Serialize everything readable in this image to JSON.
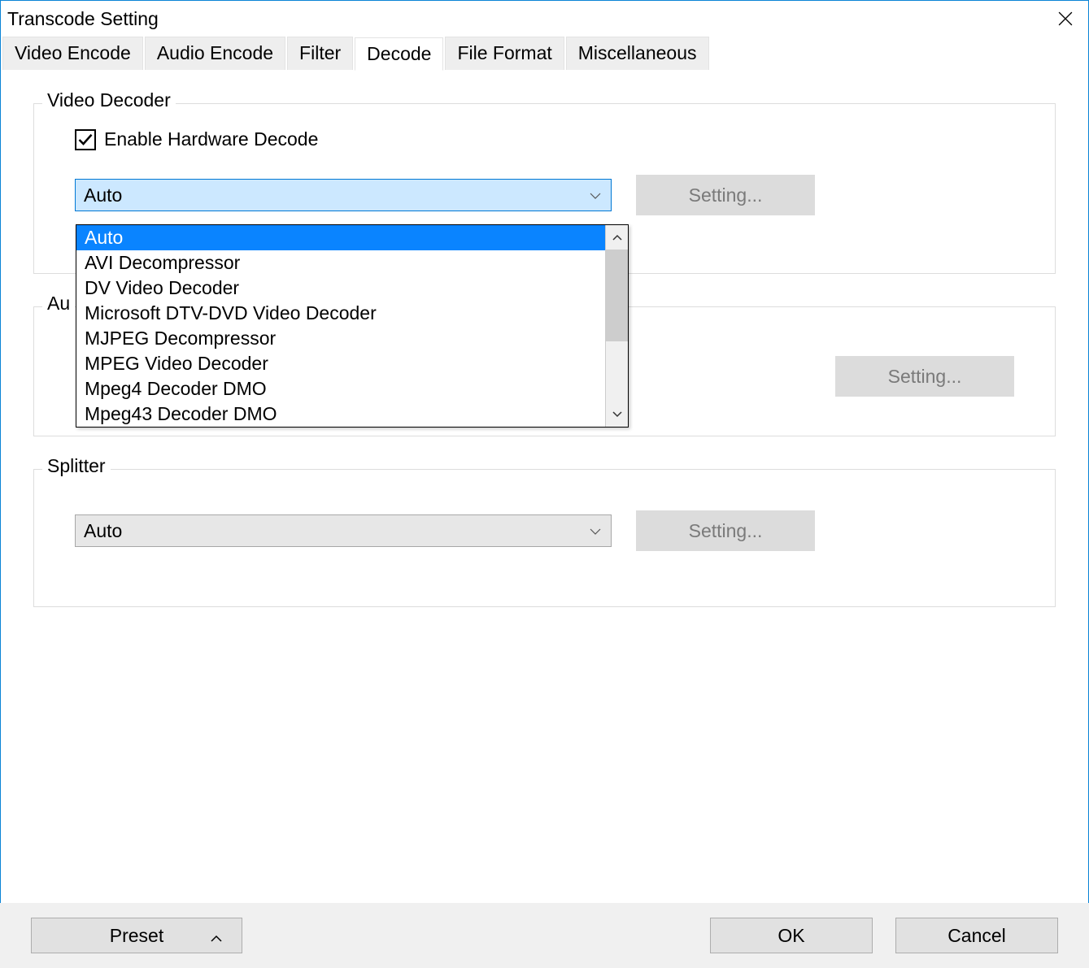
{
  "titlebar": {
    "title": "Transcode Setting"
  },
  "tabs": [
    {
      "label": "Video Encode"
    },
    {
      "label": "Audio Encode"
    },
    {
      "label": "Filter"
    },
    {
      "label": "Decode",
      "active": true
    },
    {
      "label": "File Format"
    },
    {
      "label": "Miscellaneous"
    }
  ],
  "video_decoder": {
    "group_label": "Video Decoder",
    "checkbox_label": "Enable Hardware Decode",
    "checkbox_checked": true,
    "combo_value": "Auto",
    "setting_label": "Setting...",
    "options": [
      "Auto",
      "AVI Decompressor",
      "DV Video Decoder",
      "Microsoft DTV-DVD Video Decoder",
      "MJPEG Decompressor",
      "MPEG Video Decoder",
      "Mpeg4 Decoder DMO",
      "Mpeg43 Decoder DMO"
    ]
  },
  "audio_decoder": {
    "group_label_visible": "Au",
    "setting_label": "Setting..."
  },
  "splitter": {
    "group_label": "Splitter",
    "combo_value": "Auto",
    "setting_label": "Setting..."
  },
  "footer": {
    "preset_label": "Preset",
    "ok_label": "OK",
    "cancel_label": "Cancel"
  }
}
